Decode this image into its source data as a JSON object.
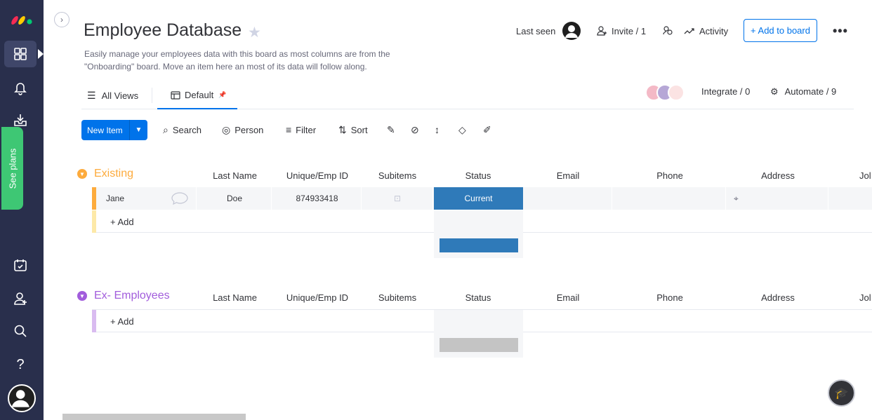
{
  "sidebar": {
    "logo": "monday-logo-icon",
    "see_plans": "See plans",
    "icons": [
      "workspace-grid-icon",
      "bell-icon",
      "inbox-download-icon",
      "calendar-check-icon",
      "add-person-icon",
      "search-icon",
      "help-icon",
      "avatar-icon"
    ],
    "help_glyph": "?"
  },
  "header": {
    "title": "Employee Database",
    "description": "Easily manage your employees data with this board as most columns are from the \"Onboarding\" board. Move an item here an most of its data will follow along.",
    "last_seen": "Last seen",
    "invite": "Invite / 1",
    "activity": "Activity",
    "add_to_board": "+ Add to board",
    "more": "•••"
  },
  "views": {
    "all_views": "All Views",
    "default": "Default"
  },
  "integrations": {
    "integrate": "Integrate / 0",
    "automate": "Automate / 9"
  },
  "toolbar": {
    "new_item": "New Item",
    "search": "Search",
    "person": "Person",
    "filter": "Filter",
    "sort": "Sort"
  },
  "columns": [
    "Last Name",
    "Unique/Emp ID",
    "Subitems",
    "Status",
    "Email",
    "Phone",
    "Address",
    "Jol"
  ],
  "groups": [
    {
      "name": "Existing",
      "color": "#fdab3d",
      "rows": [
        {
          "first": "Jane",
          "last": "Doe",
          "emp_id": "874933418",
          "status": "Current"
        }
      ],
      "add_label": "+ Add",
      "summary_color": "#2f7ab9"
    },
    {
      "name": "Ex- Employees",
      "color": "#a25ddc",
      "rows": [],
      "add_label": "+ Add",
      "summary_color": "#c4c4c4"
    }
  ]
}
